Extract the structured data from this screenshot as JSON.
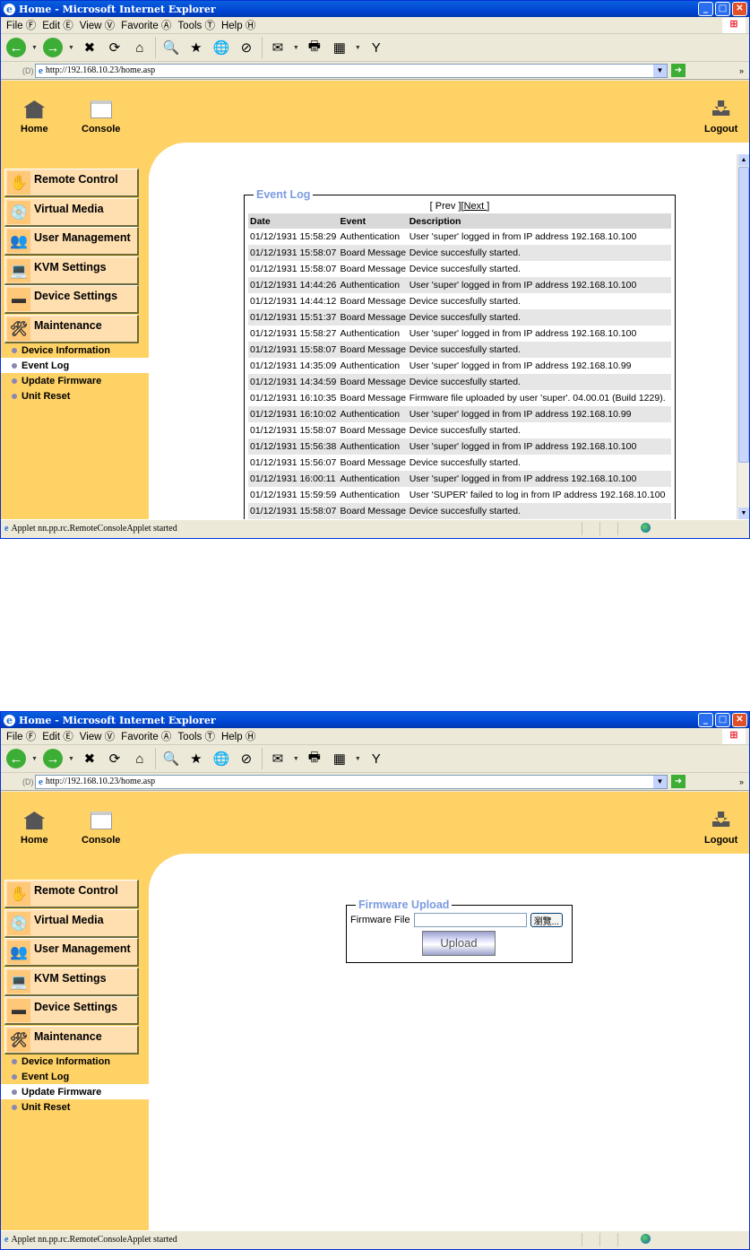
{
  "browser": {
    "title": "Home - Microsoft Internet Explorer",
    "menu": [
      "File Ⓕ",
      "Edit Ⓔ",
      "View Ⓥ",
      "Favorite Ⓐ",
      "Tools Ⓣ",
      "Help Ⓗ"
    ],
    "address_label": "(D)",
    "url": "http://192.168.10.23/home.asp",
    "status": "Applet nn.pp.rc.RemoteConsoleApplet started",
    "toolbar_icons": [
      "back-icon",
      "forward-icon",
      "stop-icon",
      "refresh-icon",
      "home-icon",
      "search-icon",
      "favorites-icon",
      "media-icon",
      "history-icon",
      "mail-icon",
      "print-icon",
      "edit-icon",
      "messenger-icon"
    ]
  },
  "nav": {
    "home": "Home",
    "console": "Console",
    "logout": "Logout",
    "sections": [
      "Remote Control",
      "Virtual Media",
      "User Management",
      "KVM Settings",
      "Device Settings",
      "Maintenance"
    ],
    "maintenance_items": [
      "Device Information",
      "Event Log",
      "Update Firmware",
      "Unit Reset"
    ]
  },
  "event_log": {
    "legend": "Event Log",
    "prev": "[ Prev ][",
    "next": "Next ",
    "pager_end": "]",
    "columns": [
      "Date",
      "Event",
      "Description"
    ],
    "rows": [
      [
        "01/12/1931 15:58:29",
        "Authentication",
        "User 'super' logged in from IP address 192.168.10.100"
      ],
      [
        "01/12/1931 15:58:07",
        "Board Message",
        "Device succesfully started."
      ],
      [
        "01/12/1931 15:58:07",
        "Board Message",
        "Device succesfully started."
      ],
      [
        "01/12/1931 14:44:26",
        "Authentication",
        "User 'super' logged in from IP address 192.168.10.100"
      ],
      [
        "01/12/1931 14:44:12",
        "Board Message",
        "Device succesfully started."
      ],
      [
        "01/12/1931 15:51:37",
        "Board Message",
        "Device succesfully started."
      ],
      [
        "01/12/1931 15:58:27",
        "Authentication",
        "User 'super' logged in from IP address 192.168.10.100"
      ],
      [
        "01/12/1931 15:58:07",
        "Board Message",
        "Device succesfully started."
      ],
      [
        "01/12/1931 14:35:09",
        "Authentication",
        "User 'super' logged in from IP address 192.168.10.99"
      ],
      [
        "01/12/1931 14:34:59",
        "Board Message",
        "Device succesfully started."
      ],
      [
        "01/12/1931 16:10:35",
        "Board Message",
        "Firmware file uploaded by user 'super'. 04.00.01 (Build 1229)."
      ],
      [
        "01/12/1931 16:10:02",
        "Authentication",
        "User 'super' logged in from IP address 192.168.10.99"
      ],
      [
        "01/12/1931 15:58:07",
        "Board Message",
        "Device succesfully started."
      ],
      [
        "01/12/1931 15:56:38",
        "Authentication",
        "User 'super' logged in from IP address 192.168.10.100"
      ],
      [
        "01/12/1931 15:56:07",
        "Board Message",
        "Device succesfully started."
      ],
      [
        "01/12/1931 16:00:11",
        "Authentication",
        "User 'super' logged in from IP address 192.168.10.100"
      ],
      [
        "01/12/1931 15:59:59",
        "Authentication",
        "User 'SUPER' failed to log in from IP address 192.168.10.100"
      ],
      [
        "01/12/1931 15:58:07",
        "Board Message",
        "Device succesfully started."
      ]
    ]
  },
  "firmware": {
    "legend": "Firmware Upload",
    "file_label": "Firmware File",
    "file_value": "",
    "browse": "瀏覽...",
    "upload": "Upload"
  },
  "colors": {
    "background": "#FFD266",
    "button": "#FFDFB0",
    "legend": "#7B9BE0"
  }
}
